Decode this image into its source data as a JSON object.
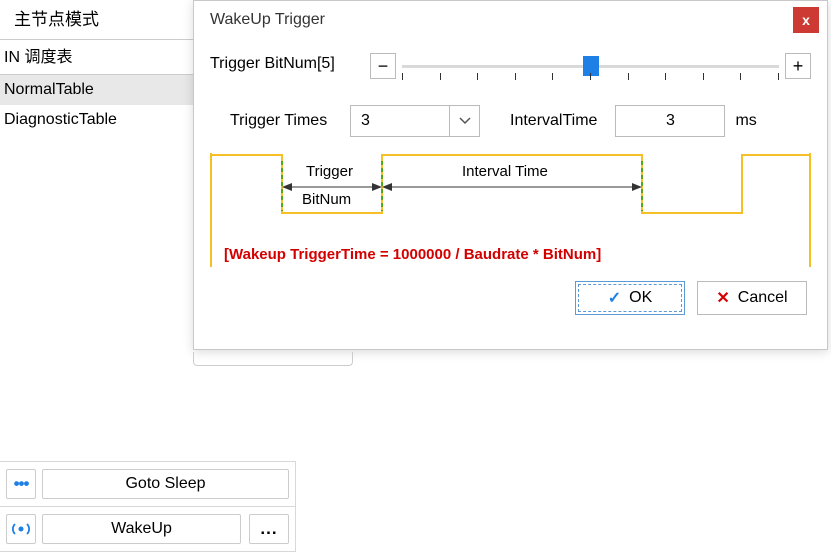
{
  "sidebar": {
    "mode_label": "主节点模式",
    "schedule_header": "IN 调度表",
    "items": [
      {
        "label": "NormalTable",
        "selected": true
      },
      {
        "label": "DiagnosticTable",
        "selected": false
      }
    ]
  },
  "bottom": {
    "sleep": {
      "icon": "…",
      "label": "Goto Sleep"
    },
    "wake": {
      "icon": "(o)",
      "label": "WakeUp",
      "ellipsis": "..."
    }
  },
  "dialog": {
    "title": "WakeUp Trigger",
    "close": "x",
    "bitnum_label": "Trigger BitNum[5]",
    "slider_value": 5,
    "minus": "−",
    "plus": "+",
    "times_label": "Trigger Times",
    "times_value": "3",
    "interval_label": "IntervalTime",
    "interval_value": "3",
    "interval_unit": "ms",
    "diagram": {
      "trigger": "Trigger",
      "bitnum": "BitNum",
      "interval": "Interval Time"
    },
    "formula": "[Wakeup TriggerTime = 1000000 / Baudrate * BitNum]",
    "ok": "OK",
    "cancel": "Cancel"
  }
}
